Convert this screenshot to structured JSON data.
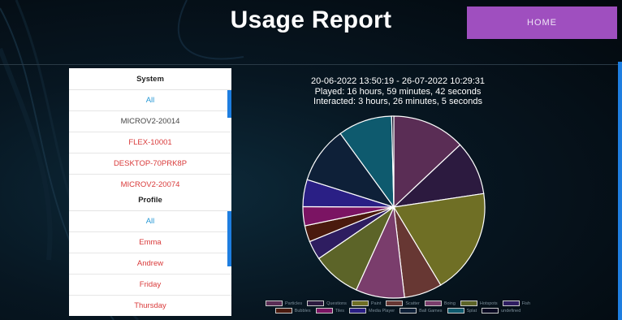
{
  "header": {
    "title": "Usage Report",
    "home_label": "HOME"
  },
  "system": {
    "header": "System",
    "items": [
      {
        "label": "All",
        "style": "blue"
      },
      {
        "label": "MICROV2-20014",
        "style": "dark"
      },
      {
        "label": "FLEX-10001",
        "style": "red"
      },
      {
        "label": "DESKTOP-70PRK8P",
        "style": "red"
      },
      {
        "label": "MICROV2-20074",
        "style": "red"
      }
    ]
  },
  "profile": {
    "header": "Profile",
    "items": [
      {
        "label": "All",
        "style": "blue"
      },
      {
        "label": "Emma",
        "style": "red"
      },
      {
        "label": "Andrew",
        "style": "red"
      },
      {
        "label": "Friday",
        "style": "red"
      },
      {
        "label": "Thursday",
        "style": "red"
      }
    ]
  },
  "report": {
    "date_range": "20-06-2022 13:50:19 - 26-07-2022 10:29:31",
    "played": "Played: 16 hours, 59 minutes, 42 seconds",
    "interacted": "Interacted: 3 hours, 26 minutes, 5 seconds"
  },
  "chart_data": {
    "type": "pie",
    "series": [
      {
        "name": "Particles",
        "value": 13.5,
        "color": "#5a2d55"
      },
      {
        "name": "Questions",
        "value": 10.0,
        "color": "#2c1a3f"
      },
      {
        "name": "Paint",
        "value": 19.5,
        "color": "#6f6f25"
      },
      {
        "name": "Scatter",
        "value": 7.0,
        "color": "#673733"
      },
      {
        "name": "Boing",
        "value": 9.0,
        "color": "#7a3d6c"
      },
      {
        "name": "Hotspots",
        "value": 9.0,
        "color": "#5c6428"
      },
      {
        "name": "Fish",
        "value": 3.5,
        "color": "#2e1d60"
      },
      {
        "name": "Bubbles",
        "value": 3.0,
        "color": "#4a1a0e"
      },
      {
        "name": "Tiles",
        "value": 3.5,
        "color": "#7b1463"
      },
      {
        "name": "Media Player",
        "value": 5.0,
        "color": "#2a1f85"
      },
      {
        "name": "Ball Games",
        "value": 10.5,
        "color": "#0e2038"
      },
      {
        "name": "Splat",
        "value": 10.0,
        "color": "#0e5a6e"
      },
      {
        "name": "undefined",
        "value": 0.4,
        "color": "#0a0a22"
      }
    ]
  }
}
